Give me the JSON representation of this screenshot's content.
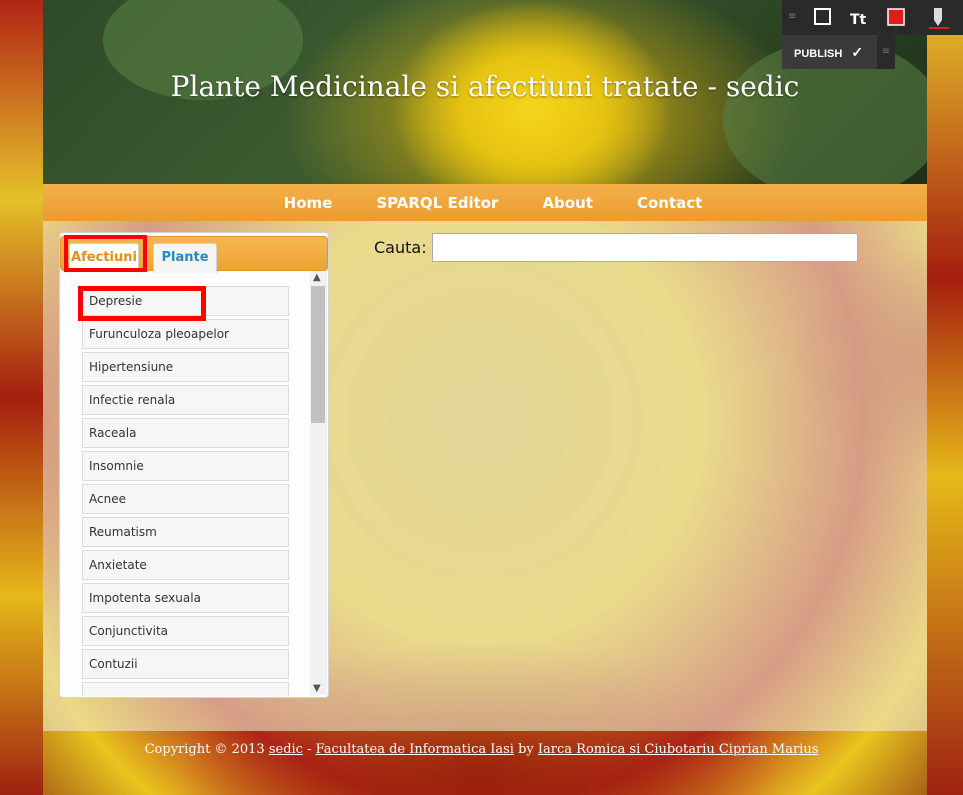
{
  "header": {
    "title": "Plante Medicinale si afectiuni tratate - sedic"
  },
  "nav": {
    "items": [
      "Home",
      "SPARQL Editor",
      "About",
      "Contact"
    ]
  },
  "sidebar": {
    "tabs": [
      "Afectiuni",
      "Plante"
    ],
    "active_tab": "Afectiuni",
    "items": [
      "Depresie",
      "Furunculoza pleoapelor",
      "Hipertensiune",
      "Infectie renala",
      "Raceala",
      "Insomnie",
      "Acnee",
      "Reumatism",
      "Anxietate",
      "Impotenta sexuala",
      "Conjunctivita",
      "Contuzii"
    ]
  },
  "search": {
    "label": "Cauta:",
    "value": ""
  },
  "footer": {
    "prefix": "Copyright © 2013 ",
    "site_link": "sedic",
    "sep1": " - ",
    "faculty_link": "Facultatea de Informatica Iasi",
    "by": " by ",
    "authors_link": "Iarca Romica si Ciubotariu Ciprian Marius"
  },
  "toolbar": {
    "publish_label": "PUBLISH",
    "icons": [
      "shape-icon",
      "text-icon",
      "color-icon",
      "pen-icon"
    ],
    "accent_color": "#e21b1b"
  },
  "colors": {
    "nav_orange": "#ec9b2e",
    "highlight": "#ff0000"
  }
}
